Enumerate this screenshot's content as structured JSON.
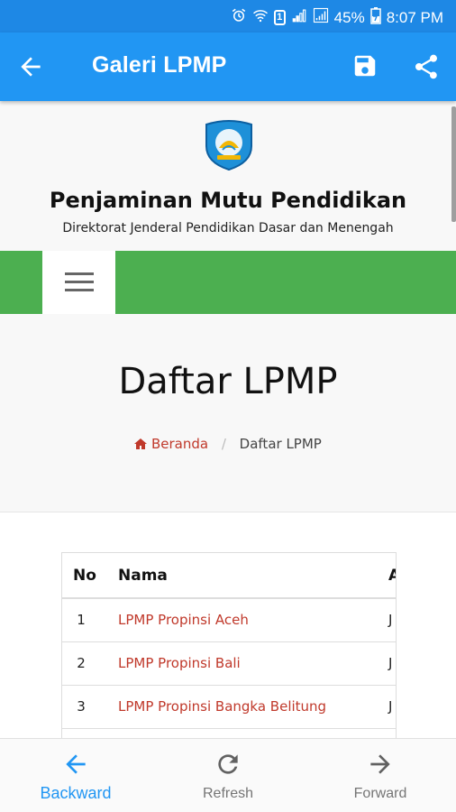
{
  "status_bar": {
    "battery": "45%",
    "time": "8:07 PM",
    "sim_badge": "1",
    "icons": [
      "alarm-icon",
      "wifi-icon",
      "signal-icon",
      "signal-icon",
      "battery-charging-icon"
    ]
  },
  "app_bar": {
    "title": "Galeri LPMP",
    "icons": [
      "back-arrow-icon",
      "save-icon",
      "share-icon"
    ],
    "color": "#2196f3"
  },
  "site": {
    "title": "Penjaminan Mutu Pendidikan",
    "subtitle": "Direktorat Jenderal Pendidikan Dasar dan Menengah",
    "nav_color": "#4caf50"
  },
  "page": {
    "title": "Daftar LPMP",
    "breadcrumb": {
      "home": "Beranda",
      "current": "Daftar LPMP"
    }
  },
  "table": {
    "headers": {
      "no": "No",
      "nama": "Nama",
      "third": "A"
    },
    "rows": [
      {
        "no": "1",
        "nama": "LPMP Propinsi Aceh",
        "third": "J"
      },
      {
        "no": "2",
        "nama": "LPMP Propinsi Bali",
        "third": "J"
      },
      {
        "no": "3",
        "nama": "LPMP Propinsi Bangka Belitung",
        "third": "J"
      }
    ]
  },
  "bottom_nav": {
    "backward": "Backward",
    "refresh": "Refresh",
    "forward": "Forward",
    "active_color": "#2196f3"
  }
}
